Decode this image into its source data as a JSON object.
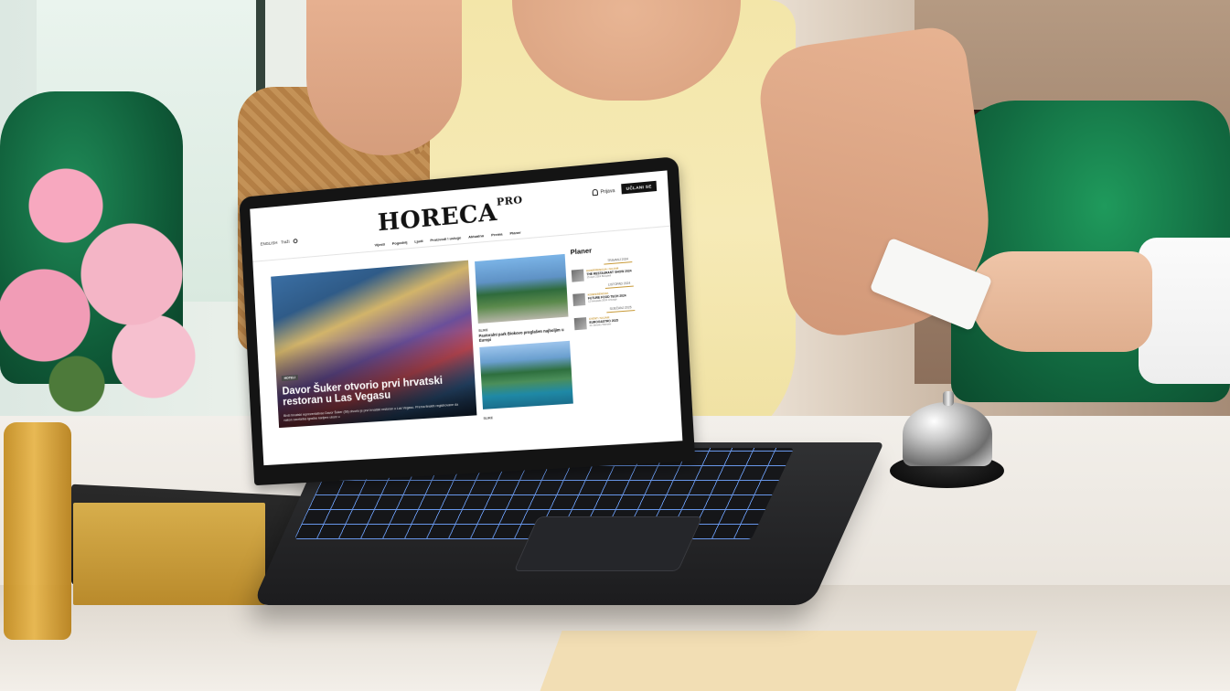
{
  "site": {
    "logo_main": "HORECA",
    "logo_super": "PRO",
    "login_label": "Prijava",
    "cta_label": "UČLANI SE",
    "lang_label": "ENGLISH",
    "search_label": "Traži",
    "menu": [
      "Vijesti",
      "Pogodnij",
      "Ljudi",
      "Proizvodi i usluge",
      "Aktualno",
      "Prema",
      "Planer"
    ]
  },
  "hero": {
    "badge": "HOTELI",
    "title": "Davor Šuker otvorio prvi hrvatski restoran u Las Vegasu",
    "subtitle": "Bivši hrvatski reprezentativac Davor Šuker (56) otvorio je prvi hrvatski restoran u Las Vegasu. Prema finskih registrovane da nakon završetka igračke karijere uloze u"
  },
  "mid": {
    "tag1": "SLIKE",
    "title1": "Pastoralni park Biokovo proglašen najboljim u Europi",
    "tag2": "SLIKE"
  },
  "planer": {
    "title": "Planer",
    "months": [
      {
        "month": "TRAVANJ 2024",
        "items": [
          {
            "meta": "KONFERENCIJA / SAJAM",
            "name": "THE RESTAURANT SHOW 2024",
            "date": "15 April 2024 Beograd"
          }
        ]
      },
      {
        "month": "LISTOPAD 2024",
        "items": [
          {
            "meta": "KONFERENCIJA",
            "name": "FUTURE FOOD TECH 2024",
            "date": "12 listopada 2024 Chicago"
          }
        ]
      },
      {
        "month": "SIJEČANJ 2025",
        "items": [
          {
            "meta": "EVENT / SAJAM",
            "name": "EUROGASTRO 2025",
            "date": "22 January Warsaw"
          }
        ]
      }
    ]
  }
}
